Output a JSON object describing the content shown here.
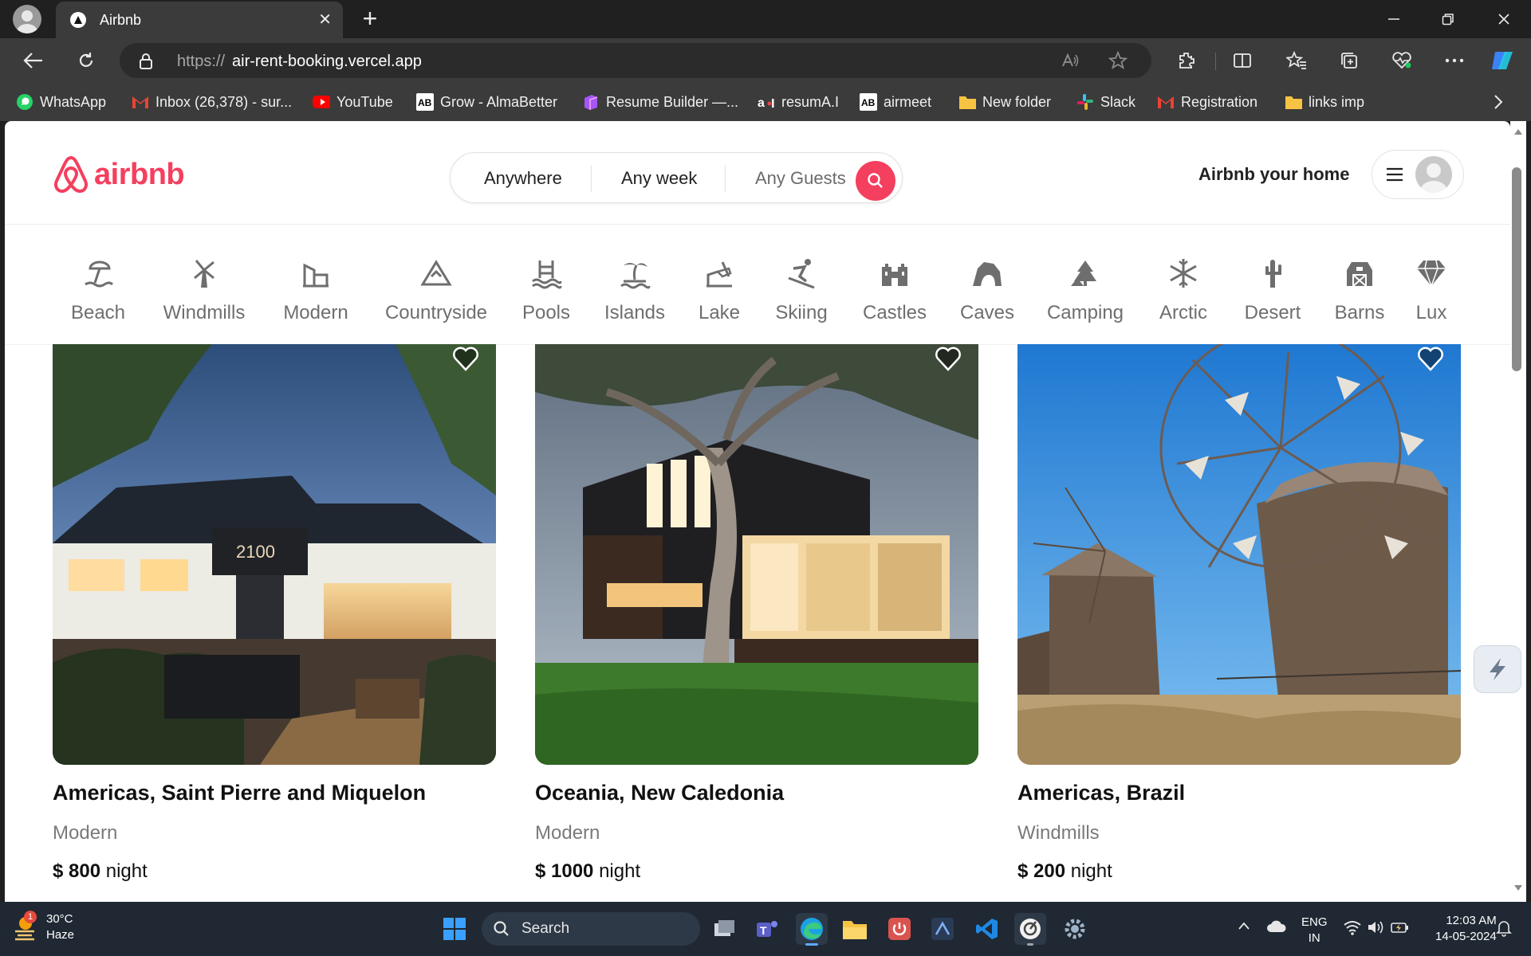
{
  "browser": {
    "tab_title": "Airbnb",
    "url_prefix": "https://",
    "url_host": "air-rent-booking.vercel.app",
    "bookmarks": [
      {
        "label": "WhatsApp",
        "icon": "whatsapp-icon",
        "color": "#25d366"
      },
      {
        "label": "Inbox (26,378) - sur...",
        "icon": "gmail-icon",
        "color": "#ea4335"
      },
      {
        "label": "YouTube",
        "icon": "youtube-icon",
        "color": "#ff0000"
      },
      {
        "label": "Grow - AlmaBetter",
        "icon": "almabetter-icon",
        "color": "#ffffff"
      },
      {
        "label": "Resume Builder —...",
        "icon": "resume-builder-icon",
        "color": "#a855f7"
      },
      {
        "label": "resumA.I",
        "icon": "resumai-icon",
        "color": "#ffffff"
      },
      {
        "label": "airmeet",
        "icon": "airmeet-icon",
        "color": "#ffffff"
      },
      {
        "label": "New folder",
        "icon": "folder-icon",
        "color": "#f6c343"
      },
      {
        "label": "Slack",
        "icon": "slack-icon",
        "color": "#e01e5a"
      },
      {
        "label": "Registration",
        "icon": "gmail-icon",
        "color": "#ea4335"
      },
      {
        "label": "links imp",
        "icon": "folder-icon",
        "color": "#f6c343"
      }
    ]
  },
  "site": {
    "logo_text": "airbnb",
    "brand_color": "#f43f5e",
    "search": {
      "where": "Anywhere",
      "when": "Any week",
      "who": "Any Guests"
    },
    "host_link": "Airbnb your home",
    "categories": [
      {
        "label": "Beach",
        "icon": "beach-icon"
      },
      {
        "label": "Windmills",
        "icon": "windmill-icon"
      },
      {
        "label": "Modern",
        "icon": "modern-icon"
      },
      {
        "label": "Countryside",
        "icon": "countryside-icon"
      },
      {
        "label": "Pools",
        "icon": "pool-icon"
      },
      {
        "label": "Islands",
        "icon": "island-icon"
      },
      {
        "label": "Lake",
        "icon": "lake-icon"
      },
      {
        "label": "Skiing",
        "icon": "skiing-icon"
      },
      {
        "label": "Castles",
        "icon": "castle-icon"
      },
      {
        "label": "Caves",
        "icon": "cave-icon"
      },
      {
        "label": "Camping",
        "icon": "camping-icon"
      },
      {
        "label": "Arctic",
        "icon": "arctic-icon"
      },
      {
        "label": "Desert",
        "icon": "desert-icon"
      },
      {
        "label": "Barns",
        "icon": "barn-icon"
      },
      {
        "label": "Lux",
        "icon": "diamond-icon"
      }
    ],
    "listings": [
      {
        "location": "Americas, Saint Pierre and Miquelon",
        "category": "Modern",
        "price": "$ 800",
        "unit": "night",
        "image": "modern-restaurant-photo"
      },
      {
        "location": "Oceania, New Caledonia",
        "category": "Modern",
        "price": "$ 1000",
        "unit": "night",
        "image": "modern-house-photo"
      },
      {
        "location": "Americas, Brazil",
        "category": "Windmills",
        "price": "$ 200",
        "unit": "night",
        "image": "windmills-photo"
      }
    ]
  },
  "taskbar": {
    "weather_temp": "30°C",
    "weather_desc": "Haze",
    "weather_badge": "1",
    "search_label": "Search",
    "lang_top": "ENG",
    "lang_bottom": "IN",
    "time": "12:03 AM",
    "date": "14-05-2024"
  }
}
